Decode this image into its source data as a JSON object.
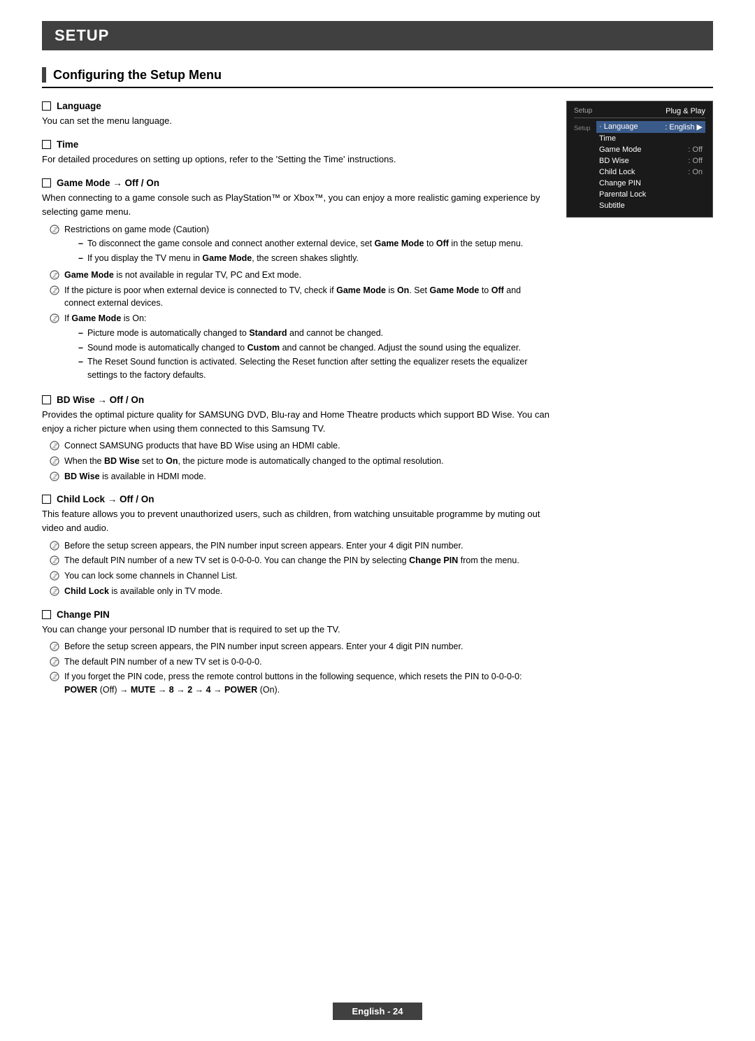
{
  "page": {
    "title": "SETUP",
    "section_title": "Configuring the Setup Menu",
    "footer_label": "English - 24"
  },
  "menu_screenshot": {
    "header_left": "Setup",
    "header_right": "Plug & Play",
    "rows": [
      {
        "label": "· Language",
        "value": "English ▶",
        "selected": true
      },
      {
        "label": "Time",
        "value": "",
        "selected": false
      },
      {
        "label": "Game Mode",
        "value": ": Off",
        "selected": false
      },
      {
        "label": "BD Wise",
        "value": ": Off",
        "selected": false
      },
      {
        "label": "Child Lock",
        "value": ": On",
        "selected": false
      },
      {
        "label": "Change PIN",
        "value": "",
        "selected": false
      },
      {
        "label": "Parental Lock",
        "value": "",
        "selected": false
      },
      {
        "label": "Subtitle",
        "value": "",
        "selected": false
      }
    ]
  },
  "topics": [
    {
      "id": "language",
      "title": "Language",
      "desc": "You can set the menu language.",
      "notes": []
    },
    {
      "id": "time",
      "title": "Time",
      "desc": "For detailed procedures on setting up options, refer to the 'Setting the Time' instructions.",
      "notes": []
    },
    {
      "id": "game-mode",
      "title": "Game Mode → Off / On",
      "desc": "When connecting to a game console such as PlayStation™ or Xbox™, you can enjoy a more realistic gaming experience by selecting game menu.",
      "notes": [
        {
          "type": "note",
          "text": "Restrictions on game mode (Caution)",
          "sub": [
            "To disconnect the game console and connect another external device, set Game Mode to Off in the setup menu.",
            "If you display the TV menu in Game Mode, the screen shakes slightly."
          ]
        },
        {
          "type": "note",
          "text": "Game Mode is not available in regular TV, PC and Ext mode.",
          "sub": []
        },
        {
          "type": "note",
          "text": "If the picture is poor when external device is connected to TV, check if Game Mode is On. Set Game Mode to Off and connect external devices.",
          "sub": []
        },
        {
          "type": "note",
          "text": "If Game Mode is On:",
          "sub": [
            "Picture mode is automatically changed to Standard and cannot be changed.",
            "Sound mode is automatically changed to Custom and cannot be changed. Adjust the sound using the equalizer.",
            "The Reset Sound function is activated. Selecting the Reset function after setting the equalizer resets the equalizer settings to the factory defaults."
          ]
        }
      ]
    },
    {
      "id": "bd-wise",
      "title": "BD Wise → Off / On",
      "desc": "Provides the optimal picture quality for SAMSUNG DVD, Blu-ray and Home Theatre products which support BD Wise. You can enjoy a richer picture when using them connected to this Samsung TV.",
      "notes": [
        {
          "type": "note",
          "text": "Connect SAMSUNG products that have BD Wise using an HDMI cable.",
          "sub": []
        },
        {
          "type": "note",
          "text": "When the BD Wise set to On, the picture mode is automatically changed to the optimal resolution.",
          "sub": []
        },
        {
          "type": "note",
          "text": "BD Wise is available in HDMI mode.",
          "sub": []
        }
      ]
    },
    {
      "id": "child-lock",
      "title": "Child Lock → Off / On",
      "desc": "This feature allows you to prevent unauthorized users, such as children, from watching unsuitable programme by muting out video and audio.",
      "notes": [
        {
          "type": "note",
          "text": "Before the setup screen appears, the PIN number input screen appears. Enter your 4 digit PIN number.",
          "sub": []
        },
        {
          "type": "note",
          "text": "The default PIN number of a new TV set is 0-0-0-0. You can change the PIN by selecting Change PIN from the menu.",
          "sub": []
        },
        {
          "type": "note",
          "text": "You can lock some channels in Channel List.",
          "sub": []
        },
        {
          "type": "note",
          "text": "Child Lock is available only in TV mode.",
          "sub": []
        }
      ]
    },
    {
      "id": "change-pin",
      "title": "Change PIN",
      "desc": "You can change your personal ID number that is required to set up the TV.",
      "notes": [
        {
          "type": "note",
          "text": "Before the setup screen appears, the PIN number input screen appears. Enter your 4 digit PIN number.",
          "sub": []
        },
        {
          "type": "note",
          "text": "The default PIN number of a new TV set is 0-0-0-0.",
          "sub": []
        },
        {
          "type": "note",
          "text": "If you forget the PIN code, press the remote control buttons in the following sequence, which resets the PIN to 0-0-0-0: POWER (Off) → MUTE → 8 → 2 → 4 → POWER (On).",
          "sub": []
        }
      ]
    }
  ]
}
